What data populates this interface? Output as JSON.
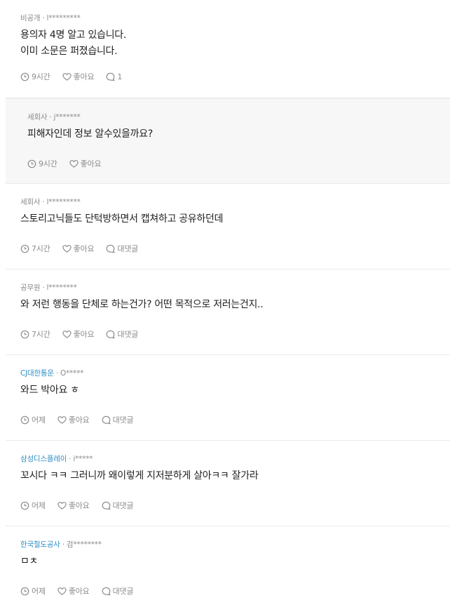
{
  "comments": [
    {
      "company": "비공개",
      "company_color": "#8a8a8a",
      "user": "l*********",
      "lines": [
        "용의자 4명 알고 있습니다.",
        "이미 소문은 퍼졌습니다."
      ],
      "time": "9시간",
      "like_label": "좋아요",
      "reply_label": "1"
    },
    {
      "company": "세회사",
      "company_color": "#8a8a8a",
      "user": "j*******",
      "lines": [
        "피해자인데 정보 알수있을까요?"
      ],
      "time": "9시간",
      "like_label": "좋아요"
    },
    {
      "company": "세회사",
      "company_color": "#8a8a8a",
      "user": "l*********",
      "lines": [
        "스토리고닉들도 단턱방하면서 캡쳐하고 공유하던데"
      ],
      "time": "7시간",
      "like_label": "좋아요",
      "reply_label": "대댓글"
    },
    {
      "company": "공무원",
      "company_color": "#8a8a8a",
      "user": "l********",
      "lines": [
        "와 저런 행동을 단체로 하는건가? 어떤 목적으로 저러는건지.."
      ],
      "time": "7시간",
      "like_label": "좋아요",
      "reply_label": "대댓글"
    },
    {
      "company": "CJ대한통운",
      "company_color": "#2f8dc6",
      "user": "O*****",
      "lines": [
        "와드 박아요 ㅎ"
      ],
      "time": "어제",
      "like_label": "좋아요",
      "reply_label": "대댓글"
    },
    {
      "company": "삼성디스플레이",
      "company_color": "#2f8dc6",
      "user": "i*****",
      "lines": [
        "꼬시다 ㅋㅋ 그러니까 왜이렇게 지저분하게 살아ㅋㅋ 잘가라"
      ],
      "time": "어제",
      "like_label": "좋아요",
      "reply_label": "대댓글"
    },
    {
      "company": "한국철도공사",
      "company_color": "#2f8dc6",
      "user": "검********",
      "lines": [
        "ㅁㅊ"
      ],
      "time": "어제",
      "like_label": "좋아요",
      "reply_label": "대댓글"
    }
  ],
  "separator": "·",
  "icons": {
    "time": "clock-icon",
    "like": "heart-icon",
    "reply": "speech-bubble-icon"
  }
}
